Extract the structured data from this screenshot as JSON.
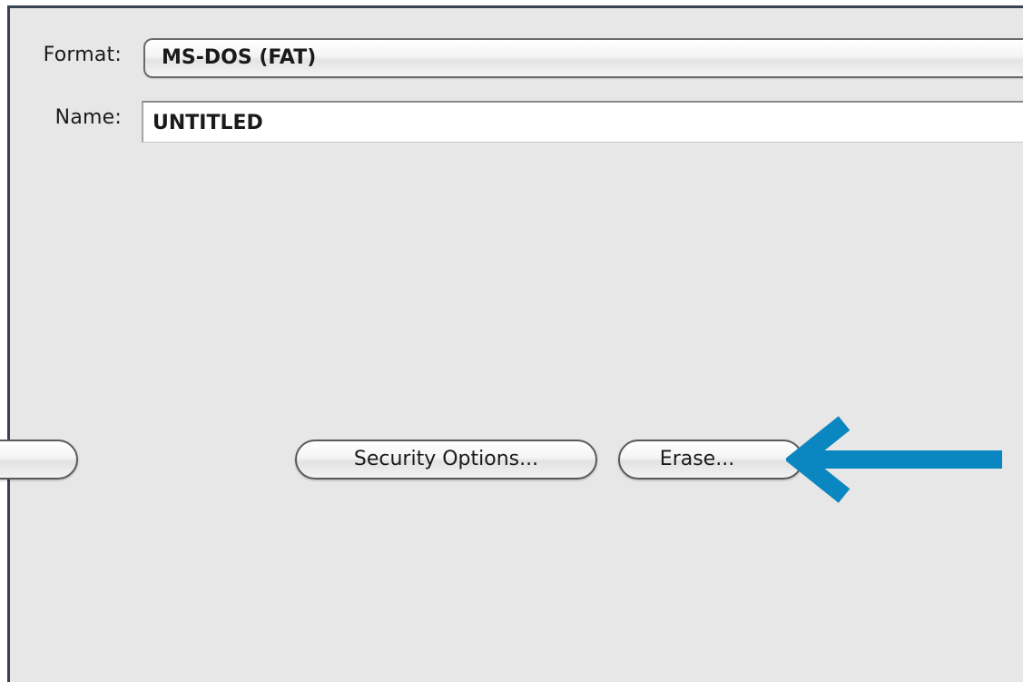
{
  "form": {
    "format_label": "Format:",
    "format_value": "MS-DOS (FAT)",
    "name_label": "Name:",
    "name_value": "UNTITLED"
  },
  "buttons": {
    "cut_off_label": "",
    "security_options_label": "Security Options...",
    "erase_label": "Erase..."
  },
  "annotation": {
    "arrow_icon": "arrow-left-icon",
    "arrow_color": "#0a86c0"
  },
  "colors": {
    "panel_bg": "#e6e7e6",
    "panel_border": "#3a4352"
  }
}
